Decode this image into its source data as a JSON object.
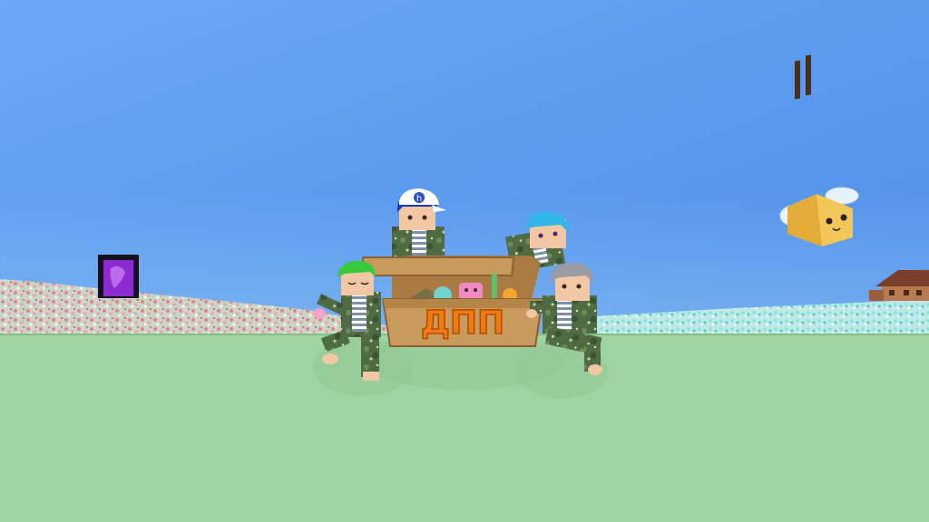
{
  "scene": {
    "chest_label": "ДПП",
    "colors": {
      "sky_top": "#6aa9f5",
      "ground": "#9fd3a3",
      "flower_field_left": "#e8808a",
      "flower_field_right": "#7fe6df",
      "portal": "#8b2bd1",
      "chest": "#c89a5b",
      "chest_label": "#f07a12",
      "bee_body": "#f3c65a",
      "camo": "#4e6b44"
    },
    "characters": [
      "green-haired-character",
      "blue-haired-cap-character",
      "cyan-haired-character",
      "gray-haired-character"
    ],
    "icons": [
      "nether-portal-icon",
      "bee-icon",
      "house-icon",
      "treasure-chest-icon"
    ]
  }
}
